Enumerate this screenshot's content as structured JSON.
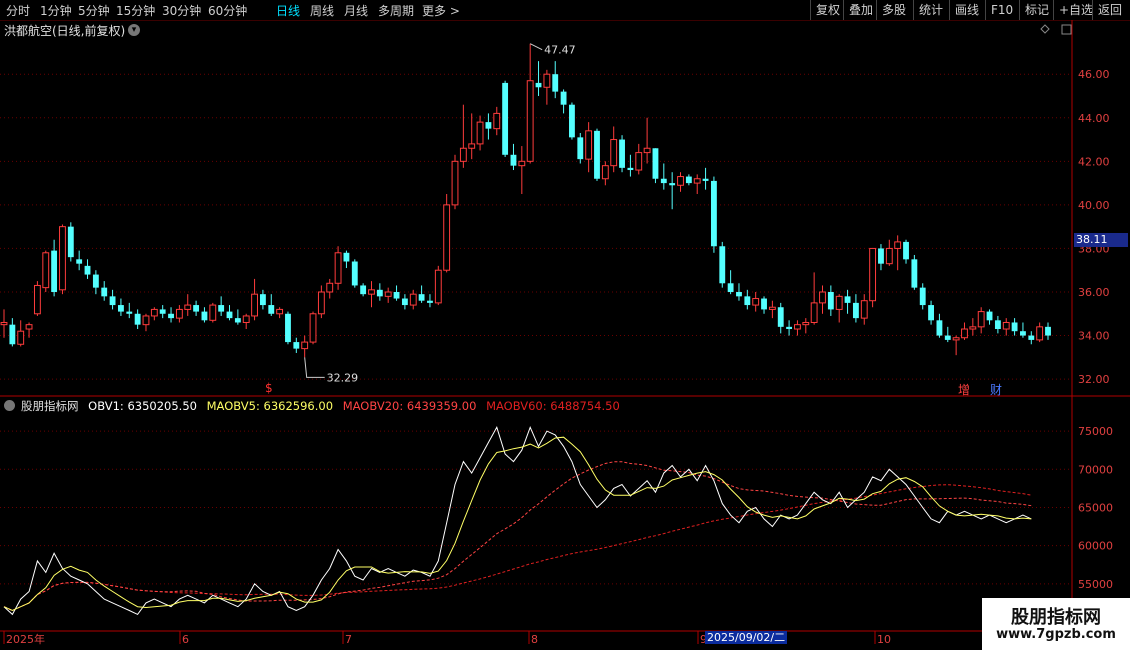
{
  "toolbar": {
    "periods": [
      "分时",
      "1分钟",
      "5分钟",
      "15分钟",
      "30分钟",
      "60分钟",
      "日线",
      "周线",
      "月线",
      "多周期",
      "更多 >"
    ],
    "active_period": "日线",
    "right_buttons": [
      "复权",
      "叠加",
      "多股",
      "统计",
      "画线",
      "F10",
      "标记",
      "+自选",
      "返回"
    ]
  },
  "stock_title": "洪都航空(日线,前复权)",
  "current_price_tag": "38.11",
  "high_label": "47.47",
  "low_label": "32.29",
  "markers": {
    "dollar": "$",
    "increase": "增",
    "finance": "财"
  },
  "indicator": {
    "name": "股朋指标网",
    "obv1": "OBV1: 6350205.50",
    "maobv5": "MAOBV5: 6362596.00",
    "maobv20": "MAOBV20: 6439359.00",
    "maobv60": "MAOBV60: 6488754.50"
  },
  "colors": {
    "up": "#ff3c3c",
    "down": "#54ffff",
    "grid": "#6a0000",
    "obv": "#ffffff",
    "ma5": "#ffff66",
    "ma20": "#ff4444",
    "ma60": "#e02020"
  },
  "price_axis": [
    "46.00",
    "44.00",
    "42.00",
    "40.00",
    "38.00",
    "36.00",
    "34.00",
    "32.00"
  ],
  "obv_axis": [
    "75000",
    "70000",
    "65000",
    "60000",
    "55000"
  ],
  "date_axis": [
    "2025年",
    "6",
    "7",
    "8",
    "9",
    "10"
  ],
  "selected_date": "2025/09/02/二",
  "watermark": {
    "name": "股朋指标网",
    "url": "www.7gpzb.com"
  },
  "chart_data": {
    "type": "candlestick",
    "price_ylim": [
      31.5,
      47.8
    ],
    "obv_ylim": [
      50000,
      77500
    ],
    "candles_ohlc": [
      [
        34.5,
        35.2,
        33.9,
        34.6
      ],
      [
        34.5,
        34.8,
        33.5,
        33.6
      ],
      [
        33.6,
        34.7,
        33.5,
        34.2
      ],
      [
        34.3,
        34.6,
        33.9,
        34.5
      ],
      [
        35.0,
        36.5,
        34.9,
        36.3
      ],
      [
        36.2,
        37.9,
        36.0,
        37.8
      ],
      [
        37.9,
        38.4,
        35.8,
        36.0
      ],
      [
        36.1,
        39.1,
        35.9,
        39.0
      ],
      [
        39.0,
        39.2,
        37.4,
        37.6
      ],
      [
        37.5,
        37.9,
        37.0,
        37.3
      ],
      [
        37.2,
        37.5,
        36.6,
        36.8
      ],
      [
        36.8,
        37.0,
        35.9,
        36.2
      ],
      [
        36.2,
        36.5,
        35.6,
        35.8
      ],
      [
        35.8,
        36.1,
        35.2,
        35.4
      ],
      [
        35.4,
        35.7,
        34.9,
        35.1
      ],
      [
        35.1,
        35.5,
        34.8,
        35.0
      ],
      [
        35.0,
        35.2,
        34.3,
        34.5
      ],
      [
        34.5,
        35.0,
        34.2,
        34.9
      ],
      [
        34.9,
        35.3,
        34.7,
        35.2
      ],
      [
        35.2,
        35.4,
        34.8,
        35.0
      ],
      [
        35.0,
        35.3,
        34.6,
        34.8
      ],
      [
        34.8,
        35.4,
        34.6,
        35.2
      ],
      [
        35.2,
        35.9,
        34.9,
        35.4
      ],
      [
        35.4,
        35.6,
        34.9,
        35.1
      ],
      [
        35.1,
        35.3,
        34.6,
        34.7
      ],
      [
        34.7,
        35.5,
        34.6,
        35.4
      ],
      [
        35.4,
        35.8,
        34.9,
        35.1
      ],
      [
        35.1,
        35.4,
        34.7,
        34.8
      ],
      [
        34.8,
        35.2,
        34.5,
        34.6
      ],
      [
        34.6,
        35.0,
        34.3,
        34.9
      ],
      [
        34.9,
        36.6,
        34.7,
        35.9
      ],
      [
        35.9,
        36.1,
        35.2,
        35.4
      ],
      [
        35.4,
        35.9,
        34.9,
        35.0
      ],
      [
        35.0,
        35.3,
        34.8,
        35.2
      ],
      [
        35.0,
        35.1,
        33.6,
        33.7
      ],
      [
        33.7,
        33.9,
        33.2,
        33.4
      ],
      [
        33.4,
        34.0,
        33.0,
        33.7
      ],
      [
        33.7,
        35.1,
        33.6,
        35.0
      ],
      [
        35.0,
        36.3,
        34.8,
        36.0
      ],
      [
        36.0,
        36.6,
        35.7,
        36.4
      ],
      [
        36.4,
        38.1,
        36.1,
        37.8
      ],
      [
        37.8,
        37.9,
        37.1,
        37.4
      ],
      [
        37.4,
        37.5,
        36.2,
        36.3
      ],
      [
        36.3,
        36.4,
        35.8,
        35.9
      ],
      [
        35.9,
        36.5,
        35.3,
        36.1
      ],
      [
        36.1,
        36.4,
        35.6,
        35.8
      ],
      [
        35.8,
        36.2,
        35.5,
        36.0
      ],
      [
        36.0,
        36.3,
        35.6,
        35.7
      ],
      [
        35.7,
        35.9,
        35.2,
        35.4
      ],
      [
        35.4,
        36.1,
        35.2,
        35.9
      ],
      [
        35.9,
        36.3,
        35.5,
        35.6
      ],
      [
        35.6,
        35.9,
        35.3,
        35.5
      ],
      [
        35.5,
        37.2,
        35.4,
        37.0
      ],
      [
        37.0,
        40.5,
        36.9,
        40.0
      ],
      [
        40.0,
        42.3,
        39.8,
        42.0
      ],
      [
        42.0,
        44.6,
        41.7,
        42.6
      ],
      [
        42.6,
        44.2,
        42.1,
        42.8
      ],
      [
        42.8,
        44.1,
        42.5,
        43.8
      ],
      [
        43.8,
        44.2,
        43.0,
        43.5
      ],
      [
        43.5,
        44.5,
        43.2,
        44.2
      ],
      [
        45.6,
        45.7,
        42.2,
        42.3
      ],
      [
        42.3,
        42.8,
        41.6,
        41.8
      ],
      [
        41.8,
        42.7,
        40.5,
        42.0
      ],
      [
        42.0,
        47.4,
        41.9,
        45.7
      ],
      [
        45.6,
        46.6,
        45.0,
        45.4
      ],
      [
        45.4,
        46.2,
        44.6,
        46.0
      ],
      [
        46.0,
        46.6,
        44.9,
        45.2
      ],
      [
        45.2,
        45.3,
        44.2,
        44.6
      ],
      [
        44.6,
        44.7,
        43.0,
        43.1
      ],
      [
        43.1,
        43.3,
        41.9,
        42.1
      ],
      [
        42.1,
        43.8,
        41.5,
        43.4
      ],
      [
        43.4,
        43.5,
        41.1,
        41.2
      ],
      [
        41.2,
        42.0,
        40.9,
        41.8
      ],
      [
        41.8,
        43.6,
        41.5,
        43.0
      ],
      [
        43.0,
        43.2,
        41.5,
        41.7
      ],
      [
        41.7,
        42.3,
        41.3,
        41.6
      ],
      [
        41.6,
        42.8,
        41.4,
        42.4
      ],
      [
        42.4,
        44.0,
        41.9,
        42.6
      ],
      [
        42.6,
        42.6,
        41.0,
        41.2
      ],
      [
        41.2,
        41.9,
        40.7,
        41.0
      ],
      [
        41.0,
        41.5,
        39.8,
        40.9
      ],
      [
        40.9,
        41.5,
        40.6,
        41.3
      ],
      [
        41.3,
        41.4,
        40.9,
        41.0
      ],
      [
        41.0,
        41.4,
        40.5,
        41.2
      ],
      [
        41.2,
        41.7,
        40.7,
        41.1
      ],
      [
        41.1,
        41.3,
        37.8,
        38.1
      ],
      [
        38.1,
        38.3,
        36.2,
        36.4
      ],
      [
        36.4,
        37.0,
        35.9,
        36.0
      ],
      [
        36.0,
        36.4,
        35.6,
        35.8
      ],
      [
        35.8,
        36.1,
        35.2,
        35.4
      ],
      [
        35.4,
        36.0,
        35.1,
        35.7
      ],
      [
        35.7,
        35.8,
        35.0,
        35.2
      ],
      [
        35.2,
        35.6,
        34.8,
        35.3
      ],
      [
        35.3,
        35.5,
        34.1,
        34.4
      ],
      [
        34.4,
        34.7,
        34.0,
        34.3
      ],
      [
        34.3,
        34.7,
        34.0,
        34.5
      ],
      [
        34.5,
        34.8,
        34.1,
        34.6
      ],
      [
        34.6,
        36.9,
        34.5,
        35.5
      ],
      [
        35.5,
        36.3,
        35.0,
        36.0
      ],
      [
        36.0,
        36.3,
        34.9,
        35.2
      ],
      [
        35.2,
        35.9,
        34.6,
        35.8
      ],
      [
        35.8,
        36.1,
        35.0,
        35.5
      ],
      [
        35.5,
        35.9,
        34.6,
        34.8
      ],
      [
        34.8,
        35.9,
        34.5,
        35.6
      ],
      [
        35.6,
        37.8,
        35.3,
        38.0
      ],
      [
        38.0,
        38.2,
        37.0,
        37.3
      ],
      [
        37.3,
        38.4,
        37.2,
        38.0
      ],
      [
        38.0,
        38.6,
        37.0,
        38.3
      ],
      [
        38.3,
        38.4,
        37.3,
        37.5
      ],
      [
        37.5,
        37.7,
        36.1,
        36.2
      ],
      [
        36.2,
        36.4,
        35.2,
        35.4
      ],
      [
        35.4,
        35.6,
        34.5,
        34.7
      ],
      [
        34.7,
        35.0,
        33.9,
        34.0
      ],
      [
        34.0,
        34.4,
        33.7,
        33.8
      ],
      [
        33.8,
        34.0,
        33.1,
        33.9
      ],
      [
        33.9,
        34.6,
        33.8,
        34.3
      ],
      [
        34.3,
        34.8,
        34.0,
        34.4
      ],
      [
        34.4,
        35.3,
        34.1,
        35.1
      ],
      [
        35.1,
        35.2,
        34.5,
        34.7
      ],
      [
        34.7,
        34.9,
        34.1,
        34.3
      ],
      [
        34.3,
        34.8,
        34.0,
        34.6
      ],
      [
        34.6,
        34.8,
        34.0,
        34.2
      ],
      [
        34.2,
        34.6,
        33.9,
        34.0
      ],
      [
        34.0,
        34.2,
        33.6,
        33.8
      ],
      [
        33.8,
        34.6,
        33.7,
        34.4
      ],
      [
        34.4,
        34.6,
        33.8,
        34.0
      ]
    ],
    "obv": [
      52000,
      51000,
      53000,
      54000,
      58000,
      56500,
      59000,
      57000,
      56000,
      55500,
      55000,
      54000,
      53000,
      52500,
      52000,
      51500,
      51000,
      52500,
      53000,
      52500,
      52000,
      53000,
      53500,
      53000,
      52500,
      53500,
      53000,
      52500,
      52000,
      53000,
      55000,
      54000,
      53500,
      54000,
      52000,
      51500,
      52000,
      53500,
      55500,
      57000,
      59500,
      58000,
      56000,
      55500,
      57000,
      56500,
      57000,
      56500,
      56000,
      56800,
      56500,
      56000,
      58000,
      63000,
      68000,
      71000,
      69500,
      71500,
      73500,
      75500,
      72000,
      71000,
      72500,
      75500,
      73000,
      75000,
      74500,
      73000,
      71000,
      68000,
      66500,
      65000,
      66000,
      67500,
      68000,
      66500,
      67500,
      68500,
      67000,
      69500,
      70500,
      69000,
      70000,
      68500,
      70500,
      68500,
      65500,
      64000,
      63000,
      64500,
      65000,
      63500,
      62500,
      64000,
      63500,
      64000,
      65500,
      67000,
      66000,
      65500,
      67000,
      65000,
      66000,
      67000,
      69000,
      68500,
      70000,
      69000,
      68000,
      66500,
      65000,
      63500,
      63000,
      64500,
      64000,
      64500,
      64000,
      63500,
      64000,
      63500,
      63000,
      63500,
      64000,
      63500
    ],
    "ma5_series_name": "MAOBV5",
    "ma20_series_name": "MAOBV20",
    "ma60_series_name": "MAOBV60",
    "obv_series_name": "OBV1"
  }
}
